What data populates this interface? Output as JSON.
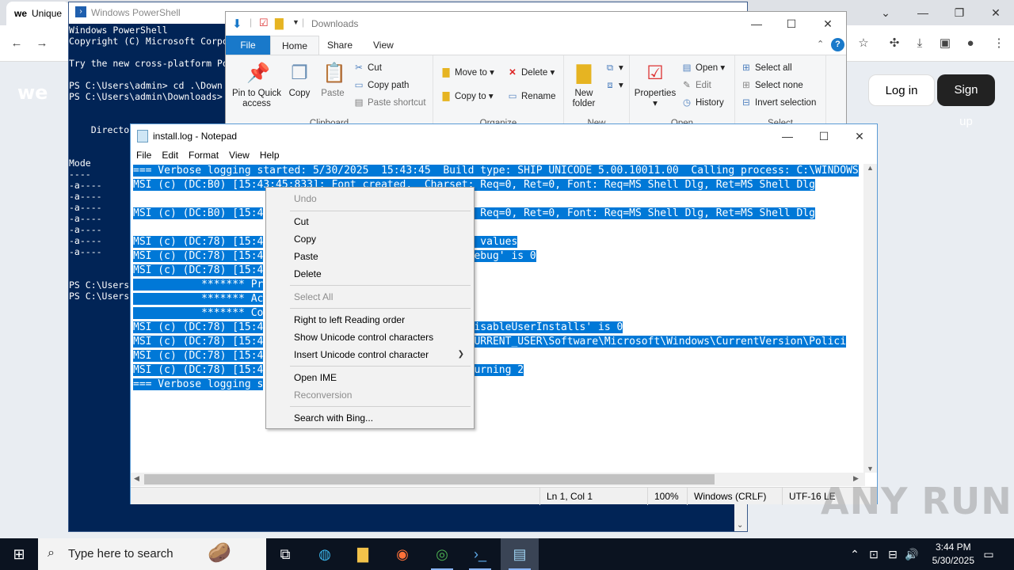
{
  "chrome": {
    "tab_title": "Unique",
    "tab_logo": "we",
    "site_logo": "we",
    "login_label": "Log in",
    "signup_label": "Sign up",
    "colors": {
      "signup_bg": "#222222"
    }
  },
  "powershell": {
    "title": "Windows PowerShell",
    "lines": [
      "Windows PowerShell",
      "Copyright (C) Microsoft Corpo",
      "",
      "Try the new cross-platform Po",
      "",
      "PS C:\\Users\\admin> cd .\\Down",
      "PS C:\\Users\\admin\\Downloads>",
      "",
      "",
      "    Directo",
      "",
      "",
      "Mode",
      "----",
      "-a----",
      "-a----",
      "-a----",
      "-a----",
      "-a----",
      "-a----",
      "-a----",
      "",
      "",
      "PS C:\\Users",
      "PS C:\\Users"
    ],
    "colors": {
      "background": "#012456"
    }
  },
  "explorer": {
    "title": "Downloads",
    "tabs": {
      "file": "File",
      "home": "Home",
      "share": "Share",
      "view": "View"
    },
    "clipboard": {
      "group": "Clipboard",
      "pin": "Pin to Quick access",
      "copy": "Copy",
      "paste": "Paste",
      "cut": "Cut",
      "copy_path": "Copy path",
      "paste_shortcut": "Paste shortcut"
    },
    "organize": {
      "group": "Organize",
      "move_to": "Move to",
      "copy_to": "Copy to",
      "delete": "Delete",
      "rename": "Rename"
    },
    "new": {
      "group": "New",
      "new_folder": "New folder"
    },
    "open": {
      "group": "Open",
      "properties": "Properties",
      "open": "Open",
      "edit": "Edit",
      "history": "History"
    },
    "select": {
      "group": "Select",
      "select_all": "Select all",
      "select_none": "Select none",
      "invert": "Invert selection"
    }
  },
  "notepad": {
    "title": "install.log - Notepad",
    "menu": [
      "File",
      "Edit",
      "Format",
      "View",
      "Help"
    ],
    "lines": [
      {
        "a": "=== Verbose logging started: 5/30/2025  15:43:45  Build type: SHIP UNICODE 5.00.10011.00  Calling process: C:\\WINDOWS",
        "b": ""
      },
      {
        "a": "MSI (c) (DC:B0) [15:43:45:833]: Font created.  Charset: Req=0, Ret=0, Font: Req=MS Shell Dlg, Ret=MS Shell Dlg",
        "b": ""
      },
      {
        "a": "",
        "b": ""
      },
      {
        "a": "MSI (c) (DC:B0) [15:4",
        "b": ": Req=0, Ret=0, Font: Req=MS Shell Dlg, Ret=MS Shell Dlg"
      },
      {
        "a": "",
        "b": ""
      },
      {
        "a": "MSI (c) (DC:78) [15:4",
        "b": "y values"
      },
      {
        "a": "MSI (c) (DC:78) [15:4",
        "b": "Debug' is 0"
      },
      {
        "a": "MSI (c) (DC:78) [15:4",
        "b": ""
      },
      {
        "a": "           ******* Pr",
        "b": ""
      },
      {
        "a": "           ******* Ac",
        "b": ""
      },
      {
        "a": "           ******* Co",
        "b": ""
      },
      {
        "a": "MSI (c) (DC:78) [15:4",
        "b": "DisableUserInstalls' is 0"
      },
      {
        "a": "MSI (c) (DC:78) [15:4",
        "b": "CURRENT_USER\\Software\\Microsoft\\Windows\\CurrentVersion\\Polici"
      },
      {
        "a": "MSI (c) (DC:78) [15:4",
        "b": "1"
      },
      {
        "a": "MSI (c) (DC:78) [15:4",
        "b": "turning 2"
      },
      {
        "a": "=== Verbose logging s",
        "b": ""
      }
    ],
    "status": {
      "position": "Ln 1, Col 1",
      "zoom": "100%",
      "line_ending": "Windows (CRLF)",
      "encoding": "UTF-16 LE"
    },
    "colors": {
      "selection": "#0078d7"
    }
  },
  "context_menu": {
    "undo": "Undo",
    "cut": "Cut",
    "copy": "Copy",
    "paste": "Paste",
    "delete": "Delete",
    "select_all": "Select All",
    "rtl": "Right to left Reading order",
    "show_unicode": "Show Unicode control characters",
    "insert_unicode": "Insert Unicode control character",
    "open_ime": "Open IME",
    "reconversion": "Reconversion",
    "search_bing": "Search with Bing..."
  },
  "taskbar": {
    "search_placeholder": "Type here to search",
    "time": "3:44 PM",
    "date": "5/30/2025"
  },
  "watermark": "ANY RUN"
}
